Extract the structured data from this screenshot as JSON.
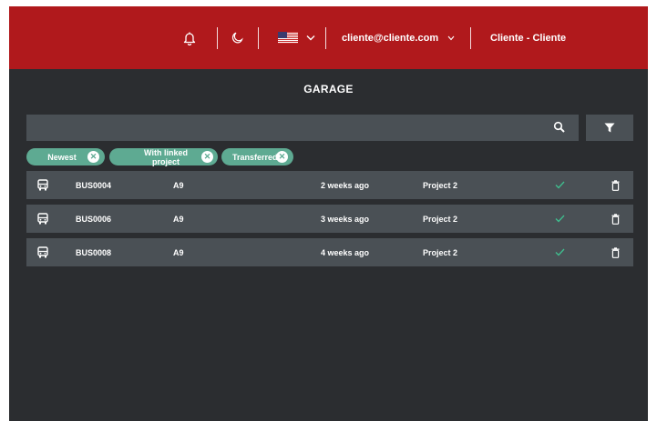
{
  "header": {
    "email": "cliente@cliente.com",
    "user": "Cliente - Cliente",
    "icons": [
      "bell-icon",
      "moon-icon",
      "us-flag-icon",
      "chevron-down-icon"
    ]
  },
  "page": {
    "title": "GARAGE"
  },
  "search": {
    "placeholder": "",
    "value": ""
  },
  "filters": [
    {
      "label": "Newest"
    },
    {
      "label": "With linked project"
    },
    {
      "label": "Transferred"
    }
  ],
  "rows": [
    {
      "code": "BUS0004",
      "type": "A9",
      "time": "2 weeks ago",
      "project": "Project 2",
      "linked": true
    },
    {
      "code": "BUS0006",
      "type": "A9",
      "time": "3 weeks ago",
      "project": "Project 2",
      "linked": true
    },
    {
      "code": "BUS0008",
      "type": "A9",
      "time": "4 weeks ago",
      "project": "Project 2",
      "linked": true
    }
  ],
  "colors": {
    "header_bg": "#b0191c",
    "page_bg": "#2b2d30",
    "row_bg": "#4a5055",
    "chip_bg": "#5eaa92",
    "check": "#3fbf8f"
  }
}
